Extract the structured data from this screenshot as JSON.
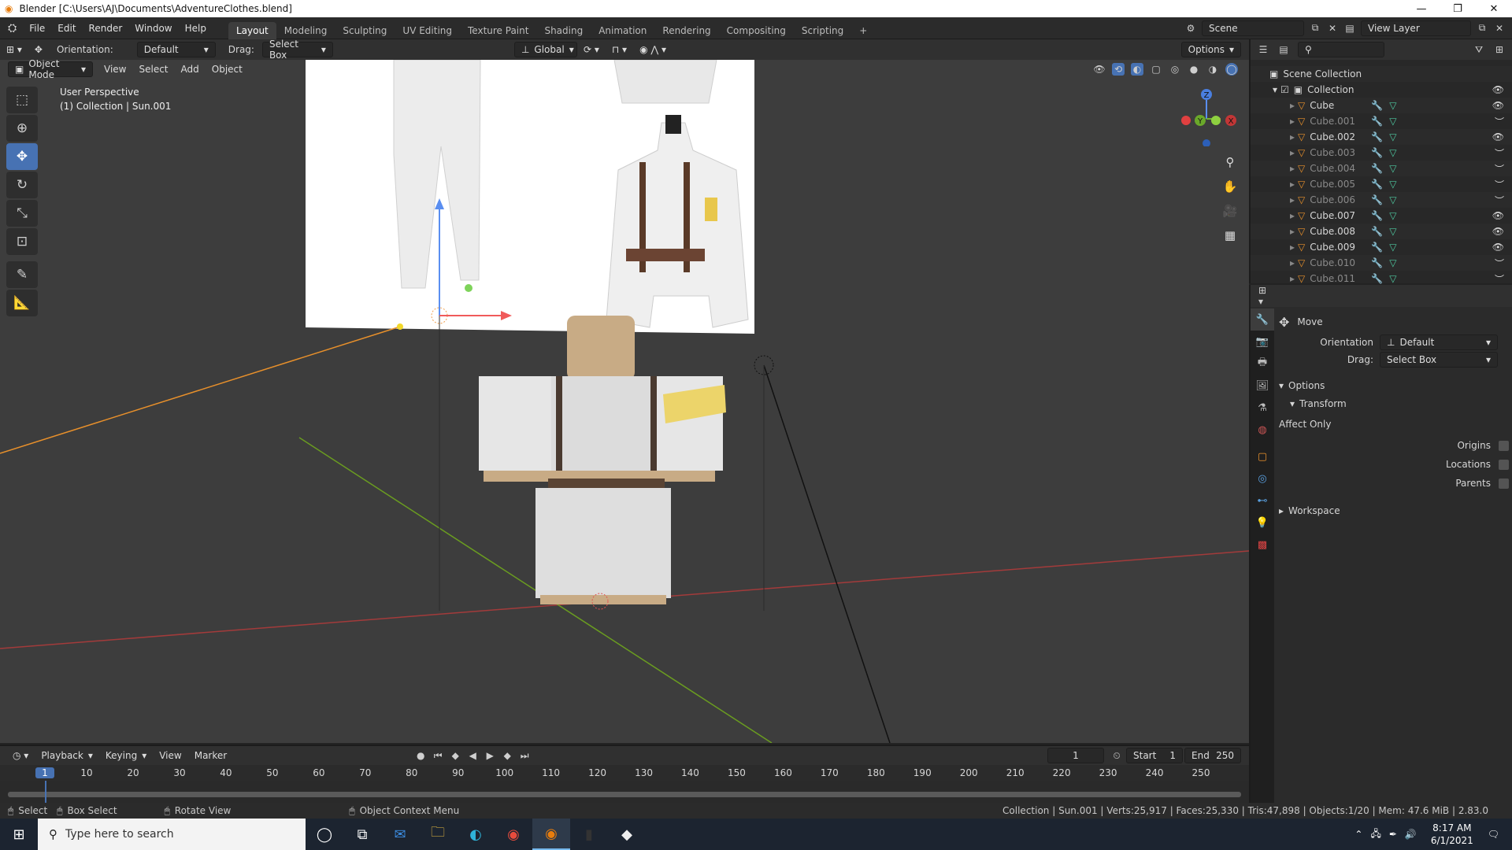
{
  "window": {
    "title": "Blender [C:\\Users\\AJ\\Documents\\AdventureClothes.blend]",
    "minimize": "—",
    "restore": "❐",
    "close": "✕"
  },
  "menu": [
    "File",
    "Edit",
    "Render",
    "Window",
    "Help"
  ],
  "workspaces": [
    "Layout",
    "Modeling",
    "Sculpting",
    "UV Editing",
    "Texture Paint",
    "Shading",
    "Animation",
    "Rendering",
    "Compositing",
    "Scripting"
  ],
  "active_workspace": "Layout",
  "scene": {
    "label": "Scene",
    "view_layer": "View Layer"
  },
  "header": {
    "orientation_label": "Orientation:",
    "orientation_value": "Default",
    "drag_label": "Drag:",
    "drag_value": "Select Box",
    "transform_space": "Global",
    "options": "Options"
  },
  "subheader": {
    "mode": "Object Mode",
    "menus": [
      "View",
      "Select",
      "Add",
      "Object"
    ]
  },
  "viewport": {
    "perspective": "User Perspective",
    "collection_info": "(1) Collection | Sun.001",
    "gizmo": {
      "z": "Z",
      "y": "Y",
      "x": "X"
    }
  },
  "outliner": {
    "root": "Scene Collection",
    "collection": "Collection",
    "items": [
      {
        "name": "Cube",
        "visible": true
      },
      {
        "name": "Cube.001",
        "visible": false
      },
      {
        "name": "Cube.002",
        "visible": true
      },
      {
        "name": "Cube.003",
        "visible": false
      },
      {
        "name": "Cube.004",
        "visible": false
      },
      {
        "name": "Cube.005",
        "visible": false
      },
      {
        "name": "Cube.006",
        "visible": false
      },
      {
        "name": "Cube.007",
        "visible": true
      },
      {
        "name": "Cube.008",
        "visible": true
      },
      {
        "name": "Cube.009",
        "visible": true
      },
      {
        "name": "Cube.010",
        "visible": false
      },
      {
        "name": "Cube.011",
        "visible": false
      }
    ]
  },
  "properties": {
    "tool_name": "Move",
    "orientation_label": "Orientation",
    "orientation_value": "Default",
    "drag_label": "Drag:",
    "drag_value": "Select Box",
    "options_panel": "Options",
    "transform_sub": "Transform",
    "affect_only": "Affect Only",
    "checks": [
      "Origins",
      "Locations",
      "Parents"
    ],
    "workspace_panel": "Workspace"
  },
  "timeline": {
    "menus": [
      "Playback",
      "Keying",
      "View",
      "Marker"
    ],
    "current_frame": "1",
    "start_label": "Start",
    "start": "1",
    "end_label": "End",
    "end": "250",
    "ticks": [
      "1",
      "10",
      "20",
      "30",
      "40",
      "50",
      "60",
      "70",
      "80",
      "90",
      "100",
      "110",
      "120",
      "130",
      "140",
      "150",
      "160",
      "170",
      "180",
      "190",
      "200",
      "210",
      "220",
      "230",
      "240",
      "250"
    ]
  },
  "statusbar": {
    "select": "Select",
    "box_select": "Box Select",
    "rotate_view": "Rotate View",
    "context_menu": "Object Context Menu",
    "stats": "Collection | Sun.001 | Verts:25,917 | Faces:25,330 | Tris:47,898 | Objects:1/20 | Mem: 47.6 MiB | 2.83.0"
  },
  "taskbar": {
    "search_placeholder": "Type here to search",
    "time": "8:17 AM",
    "date": "6/1/2021"
  }
}
